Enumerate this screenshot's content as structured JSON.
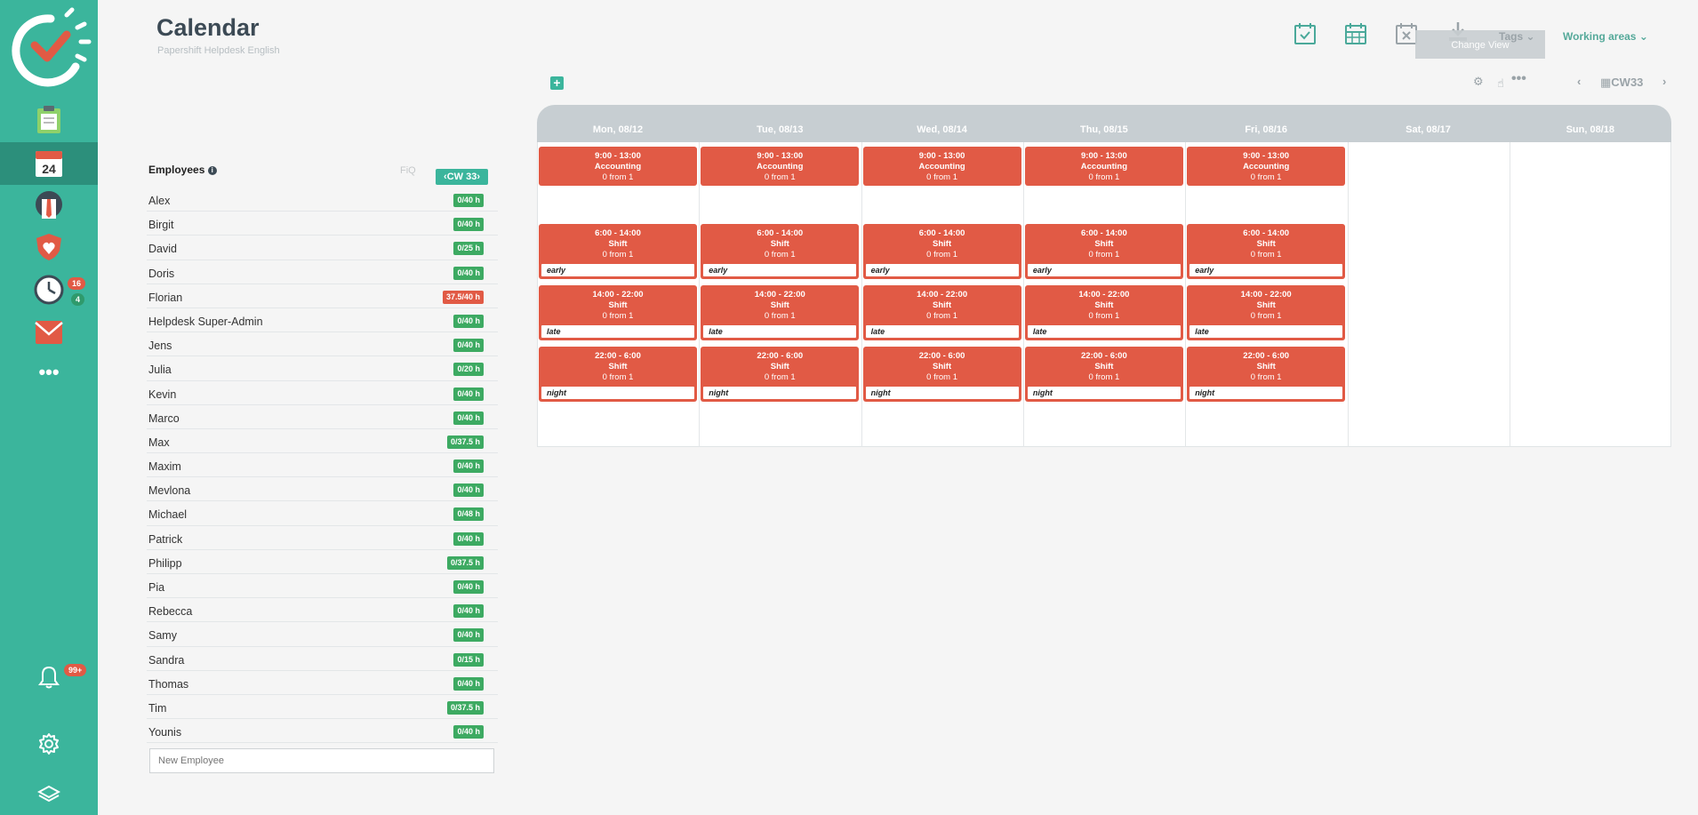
{
  "header": {
    "title": "Calendar",
    "subtitle": "Papershift Helpdesk English",
    "tags_label": "Tags",
    "working_areas_label": "Working areas",
    "tooltip": "Change View"
  },
  "sidebar": {
    "calendar_date": "24",
    "badges": {
      "clock_red": "16",
      "clock_green": "4",
      "bell": "99+"
    }
  },
  "employees": {
    "header": "Employees",
    "filter_label": "FiQ",
    "cw_label": "CW 33",
    "new_placeholder": "New Employee",
    "list": [
      {
        "name": "Alex",
        "hours": "0/40 h"
      },
      {
        "name": "Birgit",
        "hours": "0/40 h"
      },
      {
        "name": "David",
        "hours": "0/25 h"
      },
      {
        "name": "Doris",
        "hours": "0/40 h"
      },
      {
        "name": "Florian",
        "hours": "37.5/40 h",
        "over": true
      },
      {
        "name": "Helpdesk Super-Admin",
        "hours": "0/40 h"
      },
      {
        "name": "Jens",
        "hours": "0/40 h"
      },
      {
        "name": "Julia",
        "hours": "0/20 h"
      },
      {
        "name": "Kevin",
        "hours": "0/40 h"
      },
      {
        "name": "Marco",
        "hours": "0/40 h"
      },
      {
        "name": "Max",
        "hours": "0/37.5 h"
      },
      {
        "name": "Maxim",
        "hours": "0/40 h"
      },
      {
        "name": "Mevlona",
        "hours": "0/40 h"
      },
      {
        "name": "Michael",
        "hours": "0/48 h"
      },
      {
        "name": "Patrick",
        "hours": "0/40 h"
      },
      {
        "name": "Philipp",
        "hours": "0/37.5 h"
      },
      {
        "name": "Pia",
        "hours": "0/40 h"
      },
      {
        "name": "Rebecca",
        "hours": "0/40 h"
      },
      {
        "name": "Samy",
        "hours": "0/40 h"
      },
      {
        "name": "Sandra",
        "hours": "0/15 h"
      },
      {
        "name": "Thomas",
        "hours": "0/40 h"
      },
      {
        "name": "Tim",
        "hours": "0/37.5 h"
      },
      {
        "name": "Younis",
        "hours": "0/40 h"
      }
    ]
  },
  "calendar": {
    "cw_label": "CW33",
    "days": [
      "Mon, 08/12",
      "Tue, 08/13",
      "Wed, 08/14",
      "Thu, 08/15",
      "Fri, 08/16",
      "Sat, 08/17",
      "Sun, 08/18"
    ],
    "shift_rows": [
      {
        "time": "9:00 - 13:00",
        "name": "Accounting",
        "count": "0 from 1",
        "tag": ""
      },
      {
        "time": "6:00 - 14:00",
        "name": "Shift",
        "count": "0 from 1",
        "tag": "early"
      },
      {
        "time": "14:00 - 22:00",
        "name": "Shift",
        "count": "0 from 1",
        "tag": "late"
      },
      {
        "time": "22:00 - 6:00",
        "name": "Shift",
        "count": "0 from 1",
        "tag": "night"
      }
    ]
  },
  "colors": {
    "sidebar": "#3bb59c",
    "shift": "#e15a45",
    "hours_ok": "#3daa62",
    "hours_over": "#e15a45"
  }
}
